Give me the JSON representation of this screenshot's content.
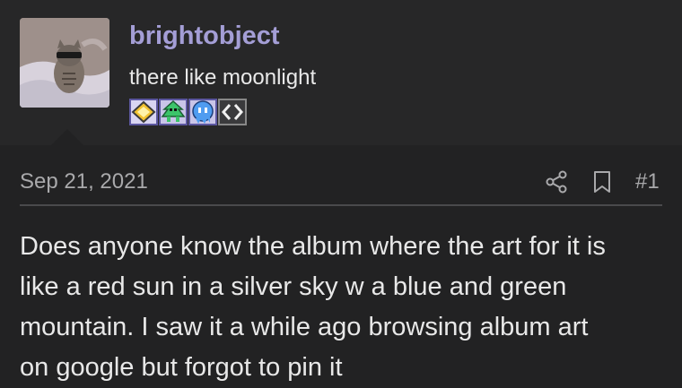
{
  "user": {
    "name": "brightobject",
    "title": "there like moonlight",
    "avatar": "cat-avatar",
    "badges": [
      "diamond-badge",
      "green-creature-badge",
      "blue-ghost-badge",
      "code-brackets-badge"
    ]
  },
  "post": {
    "date": "Sep 21, 2021",
    "number": "#1",
    "icons": [
      "share-icon",
      "bookmark-icon"
    ],
    "body_lines": [
      "Does anyone know the album where the art for it is",
      "like a red sun in a silver sky w a blue and green",
      "mountain. I saw it a while ago browsing album art",
      "on google but forgot to pin it"
    ]
  },
  "colors": {
    "username": "#a49ed6",
    "background": "#222223",
    "panel": "#272728",
    "muted_text": "#a9a9ab",
    "body_text": "#e8e8e8"
  }
}
